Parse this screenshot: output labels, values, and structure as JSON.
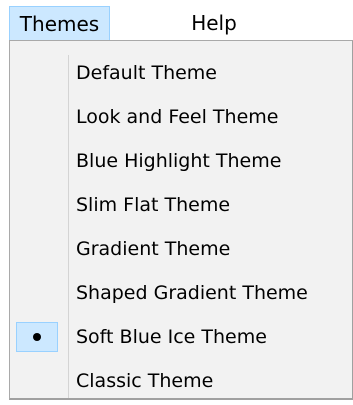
{
  "menubar": {
    "themes_label": "Themes",
    "help_label": "Help"
  },
  "themes_menu": {
    "items": [
      {
        "label": "Default Theme",
        "selected": false
      },
      {
        "label": "Look and Feel Theme",
        "selected": false
      },
      {
        "label": "Blue Highlight Theme",
        "selected": false
      },
      {
        "label": "Slim Flat Theme",
        "selected": false
      },
      {
        "label": "Gradient Theme",
        "selected": false
      },
      {
        "label": "Shaped Gradient Theme",
        "selected": false
      },
      {
        "label": "Soft Blue Ice Theme",
        "selected": true
      },
      {
        "label": "Classic Theme",
        "selected": false
      }
    ]
  },
  "colors": {
    "highlight_fill": "#cce8ff",
    "highlight_border": "#99d1ff",
    "menu_background": "#f2f2f2"
  },
  "icons": {
    "selected_marker": "bullet-icon"
  }
}
